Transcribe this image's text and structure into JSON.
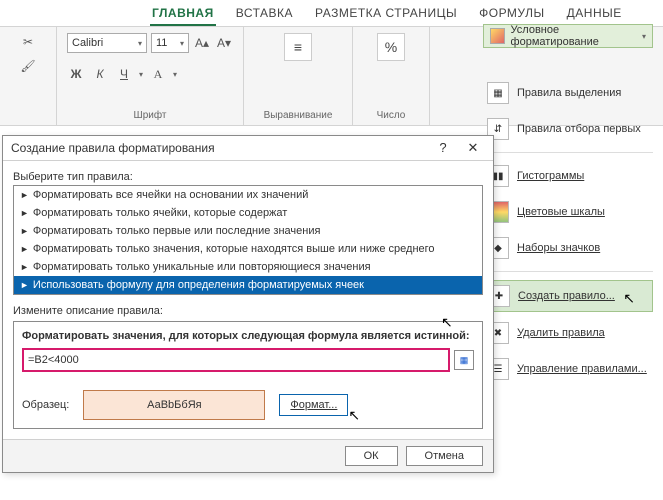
{
  "ribbon": {
    "tabs": [
      "ГЛАВНАЯ",
      "ВСТАВКА",
      "РАЗМЕТКА СТРАНИЦЫ",
      "ФОРМУЛЫ",
      "ДАННЫЕ"
    ],
    "font": {
      "name": "Calibri",
      "size": "11",
      "group_label": "Шрифт",
      "bold": "Ж",
      "italic": "К",
      "underline": "Ч",
      "inc": "A",
      "dec": "A"
    },
    "align_label": "Выравнивание",
    "number_label": "Число",
    "pct": "%"
  },
  "cf": {
    "header": "Условное форматирование",
    "items": [
      {
        "label": "Правила выделения"
      },
      {
        "label": "Правила отбора первых"
      },
      {
        "label": "Гистограммы",
        "u": 0
      },
      {
        "label": "Цветовые шкалы",
        "u": 0
      },
      {
        "label": "Наборы значков",
        "u": 0
      },
      {
        "label": "Создать правило...",
        "u": 0,
        "hl": true
      },
      {
        "label": "Удалить правила",
        "u": 0
      },
      {
        "label": "Управление правилами...",
        "u": 0
      }
    ]
  },
  "dialog": {
    "title": "Создание правила форматирования",
    "help": "?",
    "close": "✕",
    "select_label": "Выберите тип правила:",
    "rules": [
      "Форматировать все ячейки на основании их значений",
      "Форматировать только ячейки, которые содержат",
      "Форматировать только первые или последние значения",
      "Форматировать только значения, которые находятся выше или ниже среднего",
      "Форматировать только уникальные или повторяющиеся значения",
      "Использовать формулу для определения форматируемых ячеек"
    ],
    "selected_index": 5,
    "edit_label": "Измените описание правила:",
    "formula_label": "Форматировать значения, для которых следующая формула является истинной:",
    "formula_value": "=B2<4000",
    "preview_label": "Образец:",
    "preview_text": "АаВbБбЯя",
    "format_btn": "Формат...",
    "ok": "ОК",
    "cancel": "Отмена"
  }
}
